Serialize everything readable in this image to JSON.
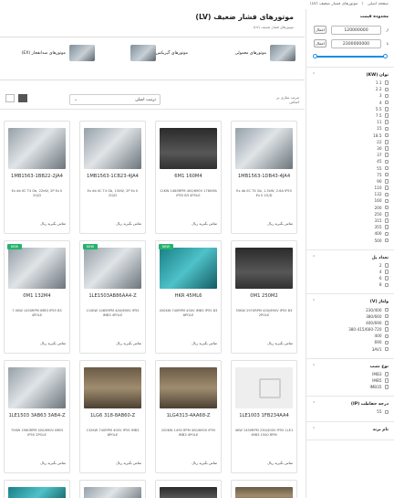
{
  "breadcrumb": [
    "صفحه اصلی",
    "موتورهای فشار ضعیف (LV)"
  ],
  "page": {
    "title": "موتورهای فشار ضعیف (LV)",
    "subtitle": "موتورهای فشار ضعیف (LV)"
  },
  "categories": [
    {
      "name": "موتورهای معمولی"
    },
    {
      "name": "موتورهای گیربکس"
    },
    {
      "name": "موتورهای ضدانفجار (EX)"
    }
  ],
  "toolbar": {
    "sort_label": "مرتب سازی بر اساس",
    "sort_value": "ترتیب اصلی"
  },
  "sidebar": {
    "price": {
      "title": "محدوده قیمت",
      "from_label": "از",
      "to_label": "تا",
      "from_value": "120000000",
      "to_value": "2300000000",
      "button": "اعمال"
    },
    "power": {
      "title": "توان (KW)",
      "options": [
        "1.1",
        "2.2",
        "3",
        "4",
        "5.5",
        "7.5",
        "11",
        "15",
        "18.5",
        "22",
        "30",
        "37",
        "45",
        "55",
        "75",
        "90",
        "110",
        "132",
        "160",
        "200",
        "250",
        "315",
        "355",
        "400",
        "500"
      ]
    },
    "poles": {
      "title": "تعداد پل",
      "options": [
        "2",
        "4",
        "6",
        "8"
      ]
    },
    "voltage": {
      "title": "ولتاژ (V)",
      "options": [
        "230/400",
        "380/660",
        "400/690",
        "380-415/660-720",
        "400",
        "690",
        "3AV1"
      ]
    },
    "mounting": {
      "title": "نوع نصب",
      "options": [
        "IMB3",
        "IMB5",
        "IMB35"
      ]
    },
    "protection": {
      "title": "درجه حفاظت (IP)",
      "options": [
        "55"
      ]
    },
    "brand": {
      "title": "نام برند",
      "options": []
    }
  },
  "products": [
    {
      "model": "1MB1563-1DB43-4JA4",
      "spec": "Ex db IIC T4 Gb, 1.5kW, 2.6A IP55 Ex II 2G/D",
      "price": "تماس بگیرید ریال",
      "img": "metal",
      "badge": ""
    },
    {
      "model": "6M1 160M4",
      "spec": "11KW 1460RPM 400/690V 1760MA IP55 B3 4POLE",
      "price": "تماس بگیرید ریال",
      "img": "dark",
      "badge": ""
    },
    {
      "model": "1MB1563-1CB23-4JA4",
      "spec": "Ex db IIC T4 Gb, 15kW, 2P Ex II 2G/D",
      "price": "تماس بگیرید ریال",
      "img": "metal",
      "badge": ""
    },
    {
      "model": "1MB1563-1BB22-2JA4",
      "spec": "Ex db IIC T4 Gb, 22kW, 2P Ex II 2G/D",
      "price": "تماس بگیرید ریال",
      "img": "metal",
      "badge": ""
    },
    {
      "model": "0M1 250M2",
      "spec": "55KW 2970RPM 400/690V IP55 B3 2POLE",
      "price": "تماس بگیرید ریال",
      "img": "dark",
      "badge": ""
    },
    {
      "model": "HKR 45ML6",
      "spec": "450KW 740RPM 400V IMB3 IP55 B3 6POLE",
      "price": "تماس بگیرید ریال",
      "img": "teal",
      "badge": "NEW"
    },
    {
      "model": "1LE1503AB86AA4-Z",
      "spec": "110KW 1485RPM 400/690V IP55 IMB3 4POLE",
      "price": "تماس بگیرید ریال",
      "img": "metal",
      "badge": "NEW"
    },
    {
      "model": "0M1 132M4",
      "spec": "7.5KW 1450RPM IMB3 IP55 B3 4POLE",
      "price": "تماس بگیرید ریال",
      "img": "metal",
      "badge": "NEW"
    },
    {
      "model": "1LE1003 1FB234AA4",
      "spec": "4KW 1450RPM 230/400V IP55 1LE1 IMB3 1500 RPM",
      "price": "تماس بگیرید ریال",
      "img": "placeholder",
      "badge": ""
    },
    {
      "model": "1LG4313-4AA68-Z",
      "spec": "200KW 1490 RPM 400/690V IP55 IMB3 4POLE",
      "price": "تماس بگیرید ریال",
      "img": "warehouse",
      "badge": ""
    },
    {
      "model": "1LG6 318-8AB60-Z",
      "spec": "132KW 740RPM 400V IP55 IMB3 8POLE",
      "price": "تماس بگیرید ریال",
      "img": "warehouse",
      "badge": ""
    },
    {
      "model": "1LE1503 3AB63 3AB4-Z",
      "spec": "75KW 2980RPM 400/690V IMB3 IP55 2POLE",
      "price": "تماس بگیرید ریال",
      "img": "metal",
      "badge": ""
    }
  ]
}
